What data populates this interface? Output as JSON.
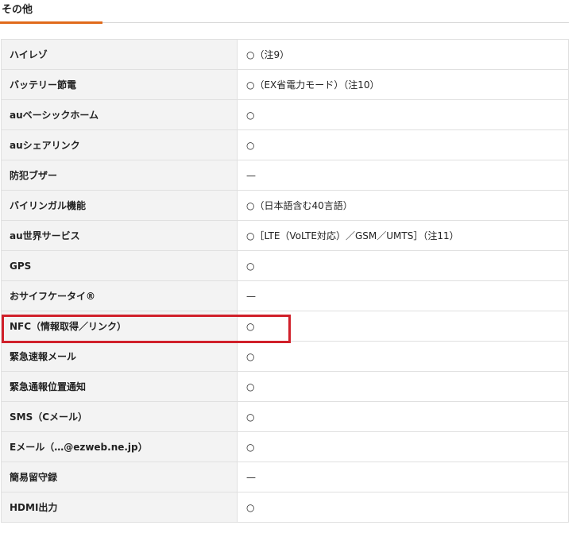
{
  "section": {
    "title": "その他"
  },
  "spec_rows": [
    {
      "label": "ハイレゾ",
      "value": "○（注9）"
    },
    {
      "label": "バッテリー節電",
      "value": "○（EX省電力モード）（注10）"
    },
    {
      "label": "auベーシックホーム",
      "value": "○"
    },
    {
      "label": "auシェアリンク",
      "value": "○"
    },
    {
      "label": "防犯ブザー",
      "value": "—"
    },
    {
      "label": "バイリンガル機能",
      "value": "○（日本語含む40言語）"
    },
    {
      "label": "au世界サービス",
      "value": "○［LTE（VoLTE対応）／GSM／UMTS］（注11）"
    },
    {
      "label": "GPS",
      "value": "○"
    },
    {
      "label": "おサイフケータイ®",
      "value": "—"
    },
    {
      "label": "NFC（情報取得／リンク）",
      "value": "○"
    },
    {
      "label": "緊急速報メール",
      "value": "○"
    },
    {
      "label": "緊急通報位置通知",
      "value": "○"
    },
    {
      "label": "SMS（Cメール）",
      "value": "○"
    },
    {
      "label": "Eメール（…@ezweb.ne.jp）",
      "value": "○"
    },
    {
      "label": "簡易留守録",
      "value": "—"
    },
    {
      "label": "HDMI出力",
      "value": "○"
    }
  ],
  "colors": {
    "accent": "#e06a1b",
    "highlight": "#d0202a",
    "label_bg": "#f3f3f3"
  }
}
